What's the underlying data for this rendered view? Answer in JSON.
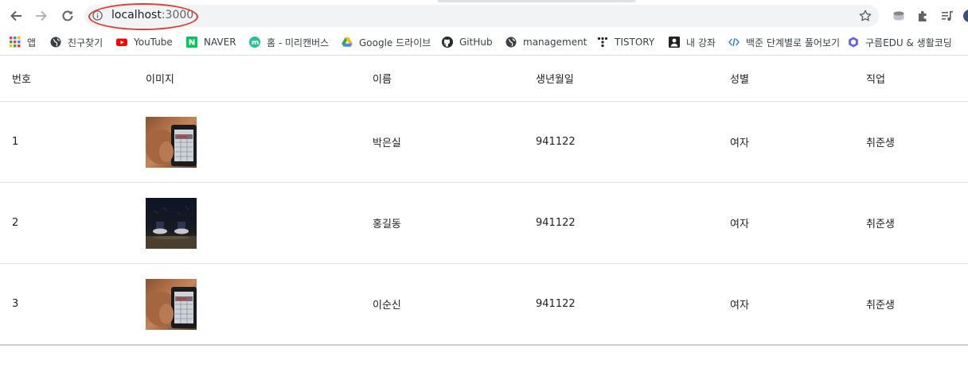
{
  "browser": {
    "url_host": "localhost",
    "url_port": ":3000",
    "highlight_color": "#e53935",
    "icons": [
      "back-icon",
      "forward-icon",
      "reload-icon",
      "info-icon",
      "star-icon",
      "extension-icon",
      "puzzle-icon",
      "playlist-icon"
    ]
  },
  "bookmarks": [
    {
      "label": "앱",
      "icon": "apps-grid-icon"
    },
    {
      "label": "친구찾기",
      "icon": "globe-icon"
    },
    {
      "label": "YouTube",
      "icon": "youtube-icon"
    },
    {
      "label": "NAVER",
      "icon": "naver-icon"
    },
    {
      "label": "홈 - 미리캔버스",
      "icon": "miricanvas-icon"
    },
    {
      "label": "Google 드라이브",
      "icon": "google-drive-icon"
    },
    {
      "label": "GitHub",
      "icon": "github-icon"
    },
    {
      "label": "management",
      "icon": "globe-icon"
    },
    {
      "label": "TISTORY",
      "icon": "tistory-icon"
    },
    {
      "label": "내 강좌",
      "icon": "person-icon"
    },
    {
      "label": "백준 단계별로 풀어보기",
      "icon": "code-icon"
    },
    {
      "label": "구름EDU & 생활코딩",
      "icon": "goorm-icon"
    }
  ],
  "table": {
    "headers": [
      "번호",
      "이미지",
      "이름",
      "생년월일",
      "성별",
      "직업"
    ],
    "rows": [
      {
        "id": "1",
        "image": "customer-photo-phone",
        "name": "박은실",
        "birthday": "941122",
        "gender": "여자",
        "job": "취준생"
      },
      {
        "id": "2",
        "image": "customer-photo-feet",
        "name": "홍길동",
        "birthday": "941122",
        "gender": "여자",
        "job": "취준생"
      },
      {
        "id": "3",
        "image": "customer-photo-phone",
        "name": "이순신",
        "birthday": "941122",
        "gender": "여자",
        "job": "취준생"
      }
    ]
  }
}
